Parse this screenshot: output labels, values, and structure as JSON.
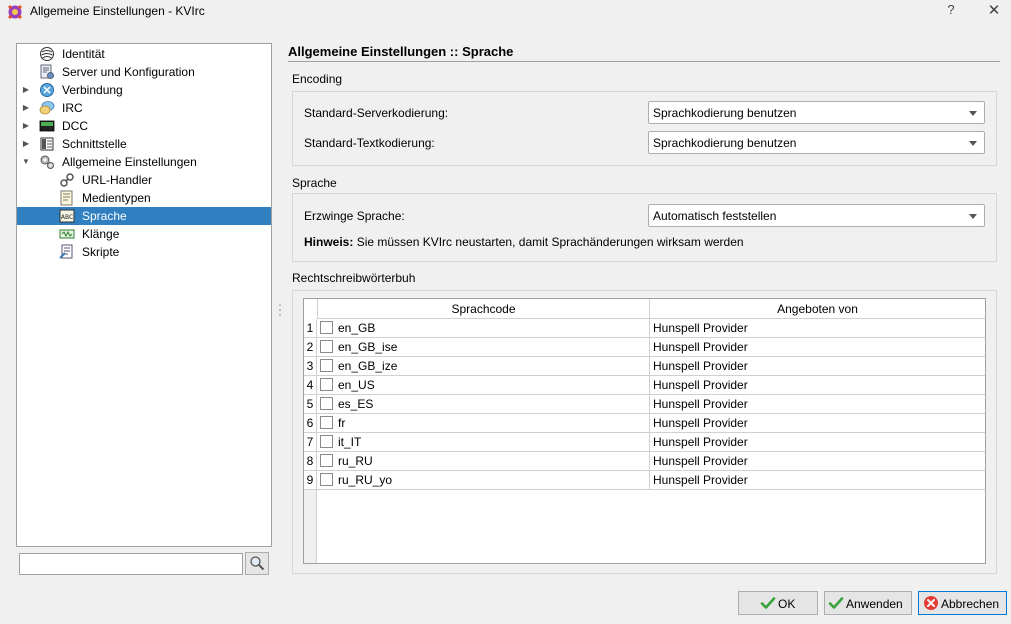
{
  "window": {
    "title": "Allgemeine Einstellungen - KVIrc",
    "help_label": "?",
    "close_label": "✕"
  },
  "sidebar": {
    "items": [
      {
        "label": "Identität",
        "icon": "identity-icon",
        "level": 0,
        "expandable": false
      },
      {
        "label": "Server und Konfiguration",
        "icon": "server-config-icon",
        "level": 0,
        "expandable": false
      },
      {
        "label": "Verbindung",
        "icon": "connection-icon",
        "level": 0,
        "expandable": true,
        "expanded": false
      },
      {
        "label": "IRC",
        "icon": "irc-icon",
        "level": 0,
        "expandable": true,
        "expanded": false
      },
      {
        "label": "DCC",
        "icon": "dcc-icon",
        "level": 0,
        "expandable": true,
        "expanded": false
      },
      {
        "label": "Schnittstelle",
        "icon": "interface-icon",
        "level": 0,
        "expandable": true,
        "expanded": false
      },
      {
        "label": "Allgemeine Einstellungen",
        "icon": "gears-icon",
        "level": 0,
        "expandable": true,
        "expanded": true
      },
      {
        "label": "URL-Handler",
        "icon": "url-handler-icon",
        "level": 1,
        "expandable": false
      },
      {
        "label": "Medientypen",
        "icon": "media-types-icon",
        "level": 1,
        "expandable": false
      },
      {
        "label": "Sprache",
        "icon": "language-icon",
        "level": 1,
        "expandable": false,
        "selected": true
      },
      {
        "label": "Klänge",
        "icon": "sounds-icon",
        "level": 1,
        "expandable": false
      },
      {
        "label": "Skripte",
        "icon": "scripts-icon",
        "level": 1,
        "expandable": false
      }
    ],
    "search_value": ""
  },
  "main": {
    "title": "Allgemeine Einstellungen :: Sprache",
    "encoding": {
      "group_label": "Encoding",
      "server_label": "Standard-Serverkodierung:",
      "server_value": "Sprachkodierung benutzen",
      "text_label": "Standard-Textkodierung:",
      "text_value": "Sprachkodierung benutzen"
    },
    "language": {
      "group_label": "Sprache",
      "force_label": "Erzwinge Sprache:",
      "force_value": "Automatisch feststellen",
      "hint_bold": "Hinweis:",
      "hint_text": "Sie müssen KVIrc neustarten, damit Sprachänderungen wirksam werden"
    },
    "spellcheck": {
      "group_label": "Rechtschreibwörterbuh",
      "columns": [
        "Sprachcode",
        "Angeboten von"
      ],
      "rows": [
        {
          "num": "1",
          "code": "en_GB",
          "provider": "Hunspell Provider",
          "checked": false
        },
        {
          "num": "2",
          "code": "en_GB_ise",
          "provider": "Hunspell Provider",
          "checked": false
        },
        {
          "num": "3",
          "code": "en_GB_ize",
          "provider": "Hunspell Provider",
          "checked": false
        },
        {
          "num": "4",
          "code": "en_US",
          "provider": "Hunspell Provider",
          "checked": false
        },
        {
          "num": "5",
          "code": "es_ES",
          "provider": "Hunspell Provider",
          "checked": false
        },
        {
          "num": "6",
          "code": "fr",
          "provider": "Hunspell Provider",
          "checked": false
        },
        {
          "num": "7",
          "code": "it_IT",
          "provider": "Hunspell Provider",
          "checked": false
        },
        {
          "num": "8",
          "code": "ru_RU",
          "provider": "Hunspell Provider",
          "checked": false
        },
        {
          "num": "9",
          "code": "ru_RU_yo",
          "provider": "Hunspell Provider",
          "checked": false
        }
      ]
    }
  },
  "buttons": {
    "ok": {
      "label": "OK",
      "icon": "check-icon"
    },
    "apply": {
      "label": "Anwenden",
      "icon": "check-icon"
    },
    "cancel": {
      "label": "Abbrechen",
      "icon": "cancel-x-icon"
    }
  },
  "colors": {
    "selection": "#2f7fc1",
    "default_button_border": "#0078d7"
  }
}
